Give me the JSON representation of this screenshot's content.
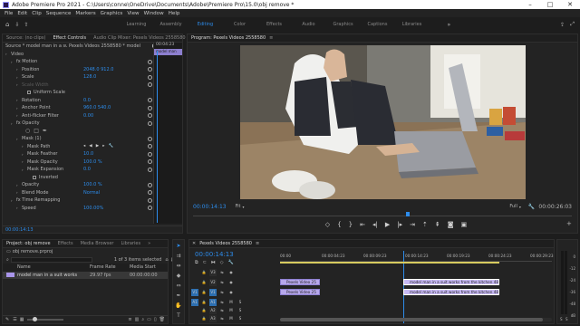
{
  "window": {
    "title": "Adobe Premiere Pro 2021 - C:\\Users\\conne\\OneDrive\\Documents\\Adobe\\Premiere Pro\\15.0\\obj remove *"
  },
  "menu": [
    "File",
    "Edit",
    "Clip",
    "Sequence",
    "Markers",
    "Graphics",
    "View",
    "Window",
    "Help"
  ],
  "workspaces": [
    "Learning",
    "Assembly",
    "Editing",
    "Color",
    "Effects",
    "Audio",
    "Graphics",
    "Captions",
    "Libraries"
  ],
  "workspace_active": "Editing",
  "source_panel": {
    "tabs": [
      "Source: (no clips)",
      "Effect Controls",
      "Audio Clip Mixer: Pexels Videos 2558580"
    ],
    "header": "Source * model man in a suit wo...",
    "sequence": "Pexels Videos 2558580 * model",
    "mini_clip": "model man",
    "timecode_top": "00:04:23",
    "timecode": "00:00:14:13",
    "rows": [
      {
        "label": "Video",
        "value": "",
        "indent": 0
      },
      {
        "label": "fx  Motion",
        "value": "",
        "indent": 1
      },
      {
        "label": "Position",
        "value": "2048.0    912.0",
        "indent": 2
      },
      {
        "label": "Scale",
        "value": "128.0",
        "indent": 2
      },
      {
        "label": "Scale Width",
        "value": "",
        "indent": 2,
        "dim": true
      },
      {
        "label": "",
        "value": "Uniform Scale",
        "indent": 3,
        "check": true
      },
      {
        "label": "Rotation",
        "value": "0.0",
        "indent": 2
      },
      {
        "label": "Anchor Point",
        "value": "960.0    540.0",
        "indent": 2
      },
      {
        "label": "Anti-flicker Filter",
        "value": "0.00",
        "indent": 2
      },
      {
        "label": "fx  Opacity",
        "value": "",
        "indent": 1
      },
      {
        "label": "",
        "value": "",
        "indent": 2,
        "shapes": true
      },
      {
        "label": "Mask (1)",
        "value": "",
        "indent": 2
      },
      {
        "label": "Mask Path",
        "value": "",
        "indent": 3,
        "path": true
      },
      {
        "label": "Mask Feather",
        "value": "10.0",
        "indent": 3
      },
      {
        "label": "Mask Opacity",
        "value": "100.0 %",
        "indent": 3
      },
      {
        "label": "Mask Expansion",
        "value": "0.0",
        "indent": 3
      },
      {
        "label": "",
        "value": "Inverted",
        "indent": 4,
        "check": true
      },
      {
        "label": "Opacity",
        "value": "100.0 %",
        "indent": 2
      },
      {
        "label": "Blend Mode",
        "value": "Normal",
        "indent": 2
      },
      {
        "label": "fx  Time Remapping",
        "value": "",
        "indent": 1
      },
      {
        "label": "Speed",
        "value": "100.00%",
        "indent": 2
      }
    ]
  },
  "program": {
    "title": "Program: Pexels Videos 2558580",
    "timecode": "00:00:14:13",
    "fit": "Fit",
    "quality": "Full",
    "duration": "00:00:26:03"
  },
  "project": {
    "tabs": [
      "Project: obj remove",
      "Effects",
      "Media Browser",
      "Libraries"
    ],
    "file": "obj remove.prproj",
    "items_selected": "1 of 3 items selected",
    "search_placeholder": "",
    "columns": [
      "Name",
      "Frame Rate",
      "Media Start"
    ],
    "rows": [
      {
        "name": "model man in a suit works",
        "rate": "29.97 fps",
        "start": "00:00:00:00"
      }
    ]
  },
  "timeline": {
    "title": "Pexels Videos 2558580",
    "timecode": "00:00:14:13",
    "ruler": [
      "00:00",
      "00:00:04:23",
      "00:00:09:23",
      "00:00:14:23",
      "00:00:19:23",
      "00:00:24:23",
      "00:00:29:23"
    ],
    "tracks": [
      "V3",
      "V2",
      "V1",
      "A1",
      "A2",
      "A3"
    ],
    "source_patch": [
      "V1",
      "A1"
    ],
    "clips": [
      {
        "track": "V2",
        "label": "Pexels Video 25"
      },
      {
        "track": "V1",
        "label": "Pexels Video 25"
      },
      {
        "track": "V2",
        "label": "model man in a suit works from the kitchen 4826.mp4"
      },
      {
        "track": "V1",
        "label": "model man in a suit works from the kitchen 4826.mp4"
      }
    ]
  },
  "meter_labels": [
    "0",
    "-12",
    "-24",
    "-36",
    "-48",
    "dB"
  ],
  "colors": {
    "accent": "#2d8ceb",
    "clip": "#b7a8ec",
    "clip_selected": "#c8baf4"
  }
}
